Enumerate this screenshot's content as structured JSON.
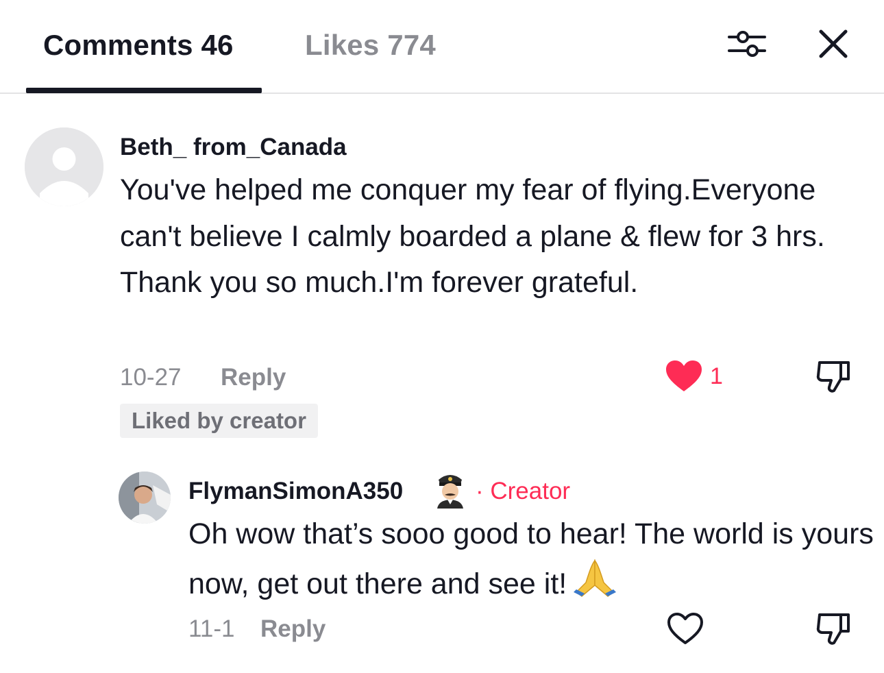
{
  "tabs": {
    "comments_label": "Comments 46",
    "likes_label": "Likes 774"
  },
  "icons": {
    "filter": "sliders-icon",
    "close": "close-icon",
    "like_filled": "heart-filled-icon",
    "like_outline": "heart-outline-icon",
    "dislike": "thumbs-down-icon"
  },
  "colors": {
    "accent": "#fe2c55",
    "text_primary": "#161823",
    "text_secondary": "#8a8b91",
    "badge_bg": "#f1f1f2"
  },
  "comments": [
    {
      "username": "Beth_ from_Canada",
      "text": "You've helped me conquer my fear of flying.Everyone can't believe I calmly boarded a plane & flew for 3 hrs. Thank you so much.I'm forever grateful.",
      "date": "10-27",
      "reply_label": "Reply",
      "like_count": "1",
      "liked": true,
      "badge": "Liked by creator",
      "replies": [
        {
          "username": "FlymanSimonA350",
          "creator_tag": "· Creator",
          "text": "Oh wow that’s sooo good to hear! The world is yours now, get out there and see it!",
          "date": "11-1",
          "reply_label": "Reply",
          "liked": false
        }
      ]
    }
  ]
}
